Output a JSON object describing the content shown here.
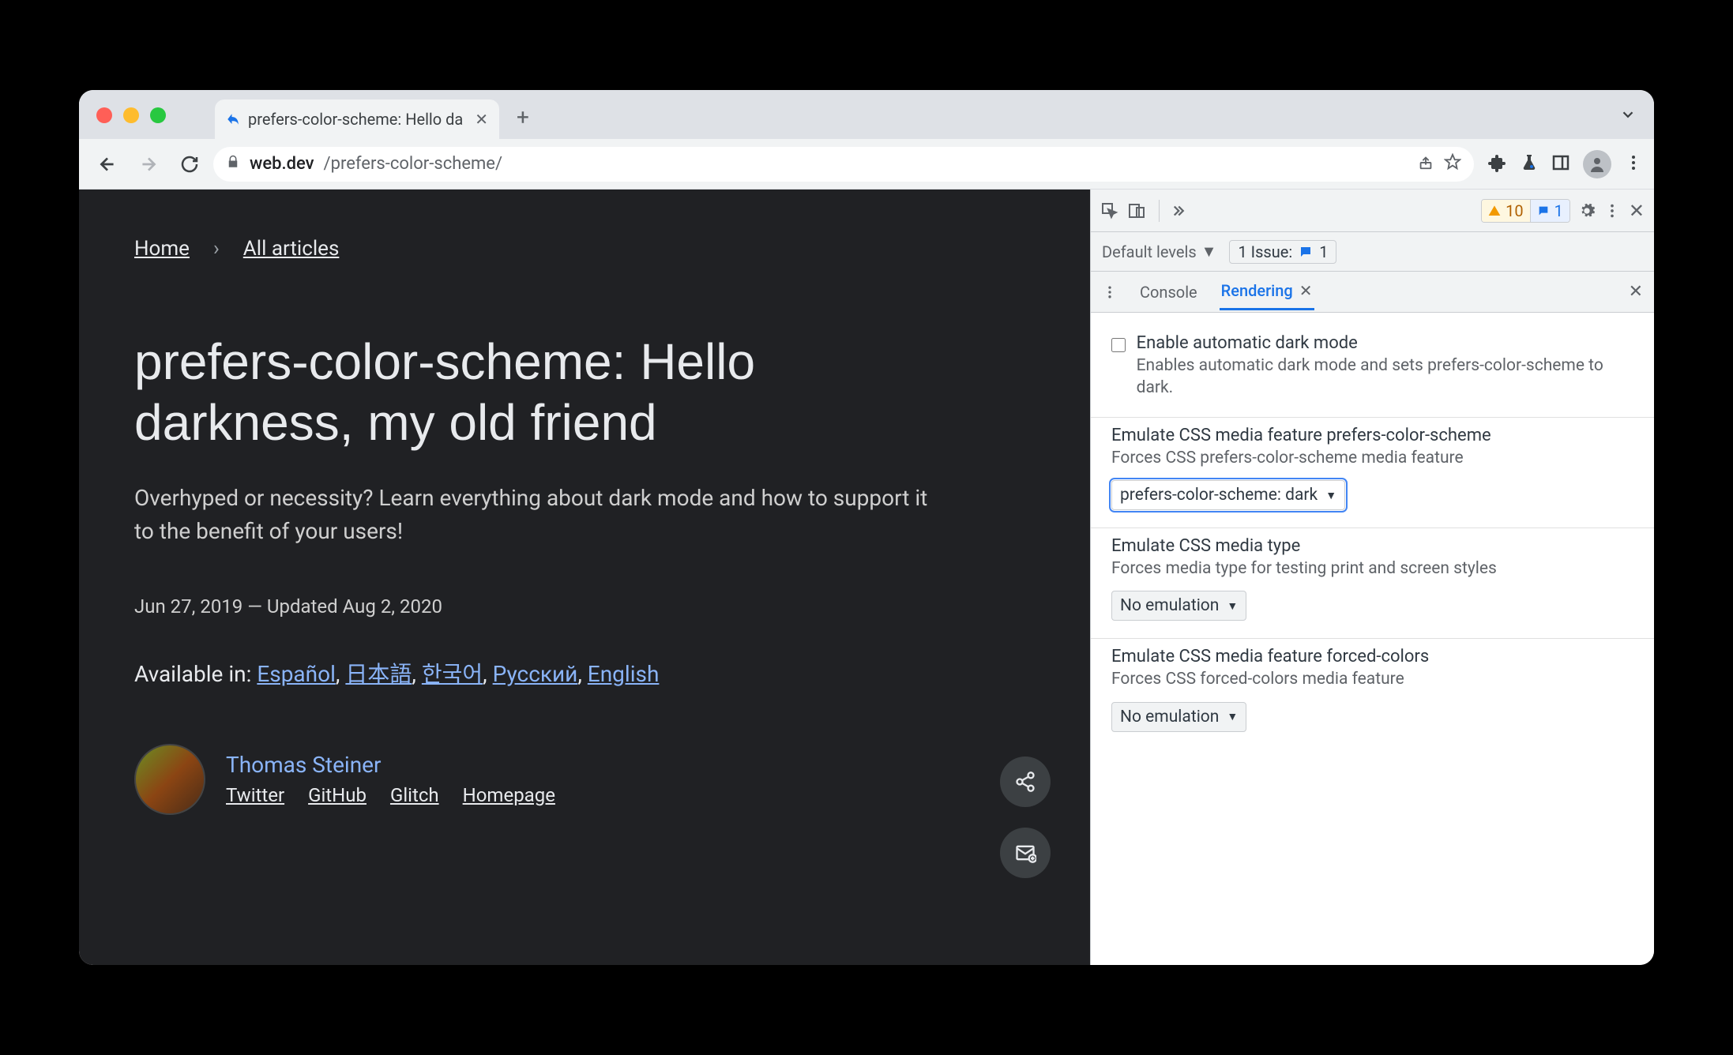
{
  "tab": {
    "title": "prefers-color-scheme: Hello da"
  },
  "omnibox": {
    "domain": "web.dev",
    "path": "/prefers-color-scheme/"
  },
  "page": {
    "breadcrumb": {
      "home": "Home",
      "all": "All articles"
    },
    "title": "prefers-color-scheme: Hello darkness, my old friend",
    "subtitle": "Overhyped or necessity? Learn everything about dark mode and how to support it to the benefit of your users!",
    "date": "Jun 27, 2019 — Updated Aug 2, 2020",
    "langs_prefix": "Available in: ",
    "langs": {
      "es": "Español",
      "ja": "日本語",
      "ko": "한국어",
      "ru": "Русский",
      "en": "English"
    },
    "author": {
      "name": "Thomas Steiner",
      "links": {
        "twitter": "Twitter",
        "github": "GitHub",
        "glitch": "Glitch",
        "home": "Homepage"
      }
    }
  },
  "devtools": {
    "warnings": "10",
    "infos": "1",
    "levels": "Default levels",
    "issue_label": "1 Issue:",
    "issue_count": "1",
    "tabs": {
      "console": "Console",
      "rendering": "Rendering"
    },
    "sections": {
      "darkmode": {
        "title": "Enable automatic dark mode",
        "desc": "Enables automatic dark mode and sets prefers-color-scheme to dark."
      },
      "pcs": {
        "title": "Emulate CSS media feature prefers-color-scheme",
        "desc": "Forces CSS prefers-color-scheme media feature",
        "value": "prefers-color-scheme: dark"
      },
      "mediatype": {
        "title": "Emulate CSS media type",
        "desc": "Forces media type for testing print and screen styles",
        "value": "No emulation"
      },
      "forcedcolors": {
        "title": "Emulate CSS media feature forced-colors",
        "desc": "Forces CSS forced-colors media feature",
        "value": "No emulation"
      }
    }
  }
}
